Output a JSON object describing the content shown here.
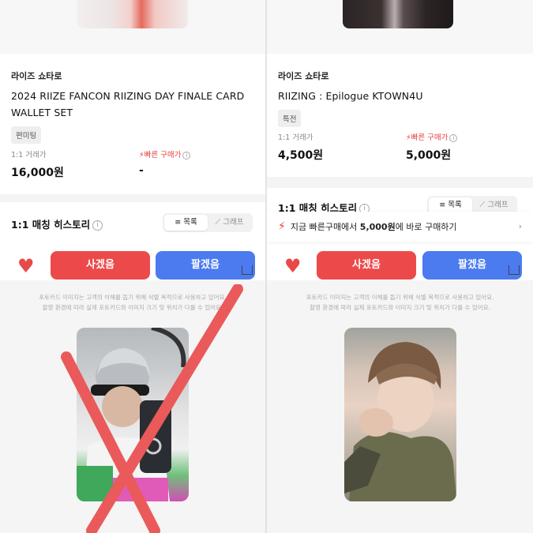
{
  "left": {
    "artist": "라이즈 쇼타로",
    "title_line1": "2024 RIIZE FANCON RIIZING DAY FINALE CARD",
    "title_line2": "WALLET SET",
    "tag": "편미팅",
    "price_label_1": "1:1 거래가",
    "price_value_1": "16,000원",
    "price_label_2": "빠른 구매가",
    "price_value_2": "-",
    "history_title": "1:1 매칭 히스토리",
    "seg_list": "목록",
    "seg_graph": "그래프",
    "buy_label": "사겠음",
    "sell_label": "팔겠음",
    "notice_line1": "포토카드 이미지는 고객의 이해를 돕기 위해 식별 목적으로 사용하고 있어요.",
    "notice_line2": "촬영 환경에 따라 실제 포토카드와 이미지 크기 및 위치가 다를 수 있어요."
  },
  "right": {
    "artist": "라이즈 쇼타로",
    "title_line1": "RIIZING : Epilogue KTOWN4U",
    "tag": "특전",
    "price_label_1": "1:1 거래가",
    "price_value_1": "4,500원",
    "price_label_2": "빠른 구매가",
    "price_value_2": "5,000원",
    "history_title": "1:1 매칭 히스토리",
    "seg_list": "목록",
    "seg_graph": "그래프",
    "banner_prefix": "지금 빠른구매에서 ",
    "banner_price": "5,000원",
    "banner_suffix": "에 바로 구매하기",
    "buy_label": "사겠음",
    "sell_label": "팔겠음",
    "notice_line1": "포토카드 이미지는 고객의 이해를 돕기 위해 식별 목적으로 사용하고 있어요.",
    "notice_line2": "촬영 환경에 따라 실제 포토카드와 이미지 크기 및 위치가 다를 수 있어요."
  },
  "colors": {
    "accent_red": "#e8403d",
    "buy_button": "#ec4a4a",
    "sell_button": "#4b7bef",
    "cross_mark": "#ea5a5a"
  },
  "icons": {
    "fast": "lightning-bolt-icon",
    "help": "info-circle-icon",
    "like": "heart-icon",
    "chevron": "chevron-right-icon",
    "list": "list-icon",
    "graph": "chart-icon"
  }
}
